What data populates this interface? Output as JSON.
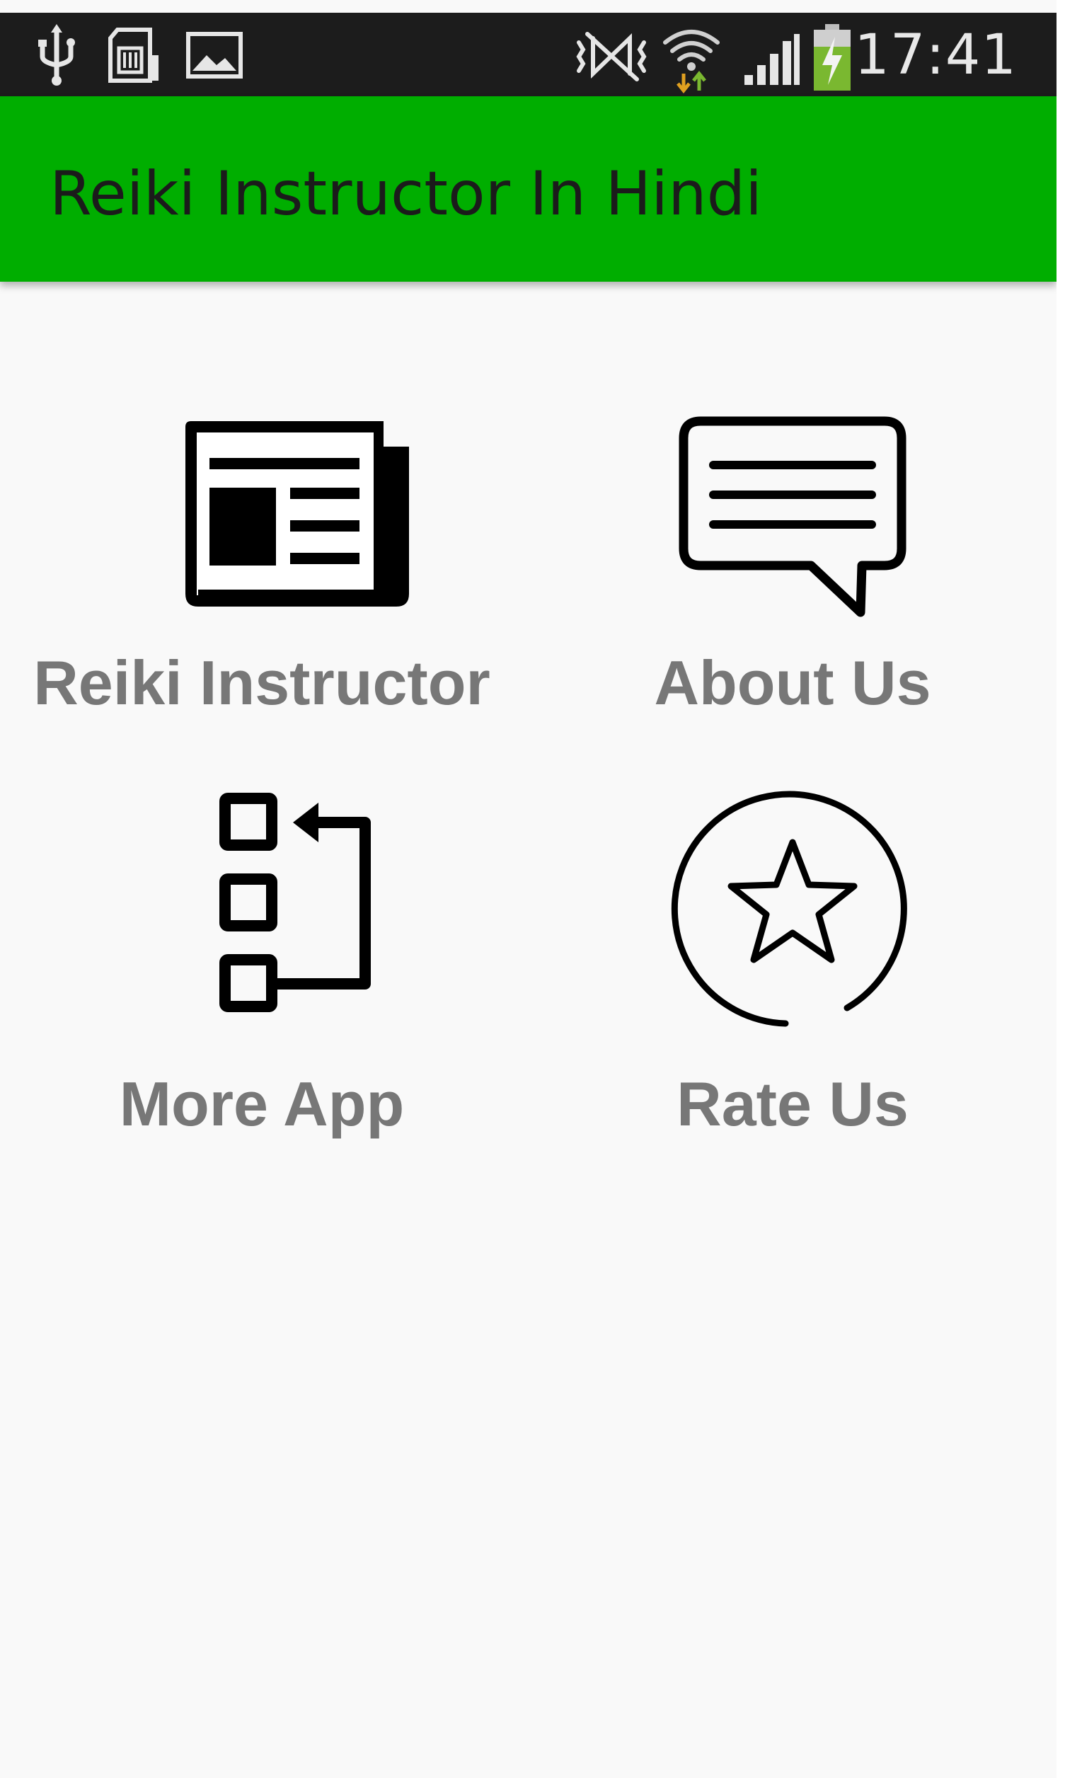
{
  "status_bar": {
    "time": "17:41",
    "icons": [
      "usb-icon",
      "sd-card-icon",
      "image-icon",
      "nfc-icon",
      "wifi-icon",
      "signal-icon",
      "battery-charging-icon"
    ]
  },
  "action_bar": {
    "title": "Reiki Instructor In Hindi",
    "color": "#00ae00"
  },
  "menu": {
    "items": [
      {
        "label": "Reiki Instructor",
        "icon": "newspaper-icon"
      },
      {
        "label": "About Us",
        "icon": "chat-bubble-icon"
      },
      {
        "label": "More App",
        "icon": "more-apps-icon"
      },
      {
        "label": "Rate Us",
        "icon": "star-circle-icon"
      }
    ]
  },
  "colors": {
    "status_bar": "#1c1c1c",
    "background": "#f9f9f9",
    "label_text": "#777777"
  }
}
